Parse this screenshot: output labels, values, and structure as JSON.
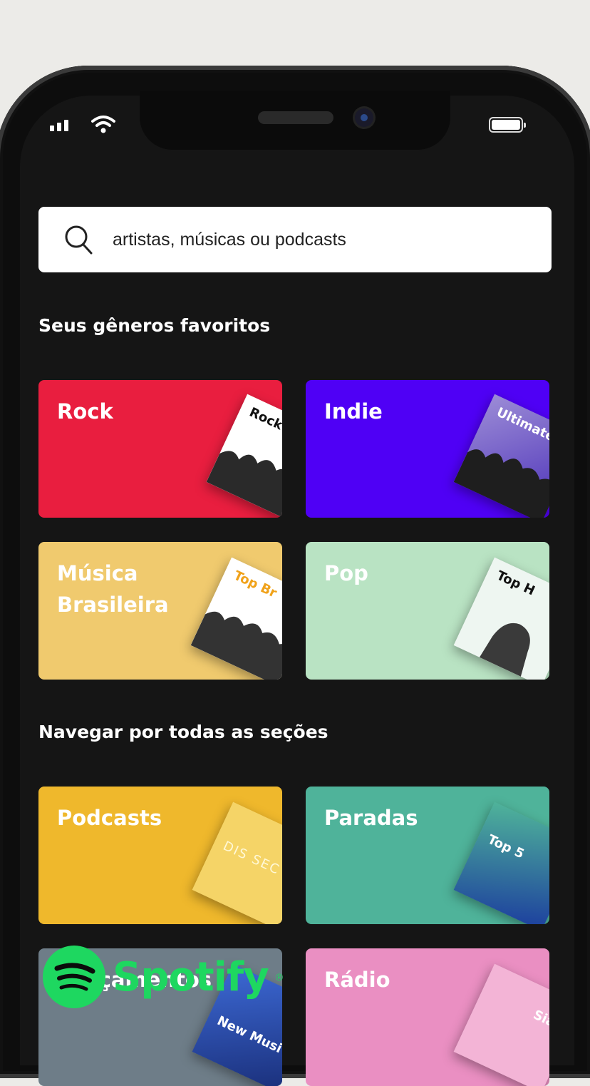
{
  "search": {
    "placeholder": "artistas, músicas ou podcasts"
  },
  "sections": {
    "favorites_title": "Seus gêneros favoritos",
    "browse_title": "Navegar por todas as seções"
  },
  "favorite_genres": [
    {
      "label": "Rock",
      "color": "#e91e3f",
      "cover_text": "Rock T"
    },
    {
      "label": "Indie",
      "color": "#4f00f5",
      "cover_text": "Ultimate I"
    },
    {
      "label": "Música\nBrasileira",
      "color": "#f0ca6e",
      "cover_text": "Top Br"
    },
    {
      "label": "Pop",
      "color": "#b9e3c3",
      "cover_text": "Top H"
    }
  ],
  "browse_sections": [
    {
      "label": "Podcasts",
      "color": "#efb82c",
      "cover_text": "DIS SEC"
    },
    {
      "label": "Paradas",
      "color": "#4fb39a",
      "cover_text": "Top 5"
    },
    {
      "label": "Lançamentos",
      "color": "#6e7d88",
      "cover_text": "New Musi"
    },
    {
      "label": "Rádio",
      "color": "#ea8fc2",
      "cover_text": "Sia"
    }
  ],
  "brand": {
    "name": "Spotify",
    "color": "#1ed760"
  },
  "status_bar": {
    "icons": [
      "signal-icon",
      "wifi-icon",
      "battery-icon"
    ]
  }
}
